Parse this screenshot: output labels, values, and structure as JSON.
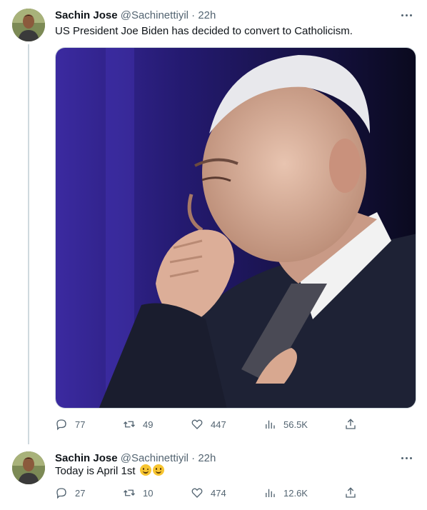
{
  "tweets": [
    {
      "name": "Sachin Jose",
      "handle": "@Sachinettiyil",
      "separator": "·",
      "time": "22h",
      "text": "US President Joe Biden has decided to convert to Catholicism.",
      "stats": {
        "replies": "77",
        "retweets": "49",
        "likes": "447",
        "views": "56.5K"
      }
    },
    {
      "name": "Sachin Jose",
      "handle": "@Sachinettiyil",
      "separator": "·",
      "time": "22h",
      "text": "Today is April 1st",
      "emojis": [
        "winking-face-with-tongue-icon",
        "grinning-face-icon"
      ],
      "stats": {
        "replies": "27",
        "retweets": "10",
        "likes": "474",
        "views": "12.6K"
      }
    }
  ],
  "colors": {
    "text": "#0f1419",
    "secondary": "#536471",
    "border": "#cfd9de"
  },
  "icons": [
    "reply-icon",
    "retweet-icon",
    "like-icon",
    "views-icon",
    "share-icon",
    "more-icon"
  ]
}
